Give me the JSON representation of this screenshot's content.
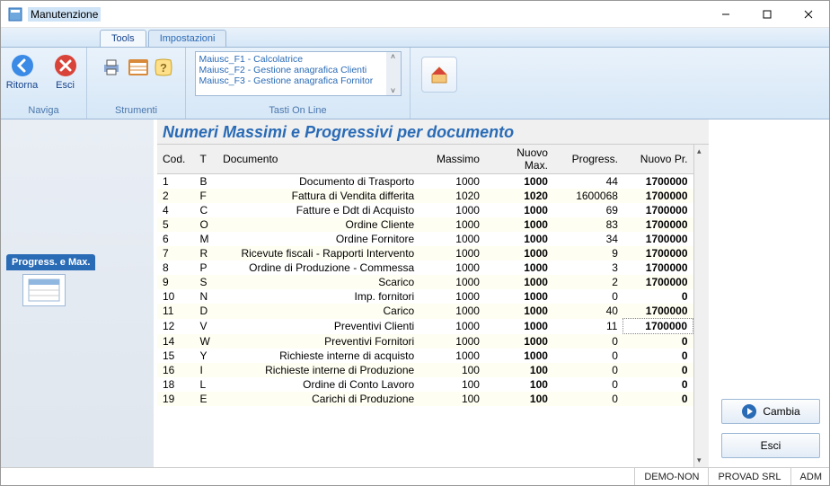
{
  "window": {
    "title": "Manutenzione"
  },
  "tabs": {
    "tools": "Tools",
    "impostazioni": "Impostazioni"
  },
  "ribbon": {
    "naviga": {
      "label": "Naviga",
      "ritorna": "Ritorna",
      "esci": "Esci"
    },
    "strumenti": {
      "label": "Strumenti"
    },
    "tasti": {
      "label": "Tasti On Line",
      "lines": [
        "Maiusc_F1  - Calcolatrice",
        "Maiusc_F2  - Gestione anagrafica Clienti",
        "Maiusc_F3  - Gestione anagrafica Fornitor"
      ]
    }
  },
  "sidebar": {
    "tab": "Progress.  e Max."
  },
  "heading": "Numeri Massimi e Progressivi per documento",
  "columns": {
    "cod": "Cod.",
    "t": "T",
    "documento": "Documento",
    "massimo": "Massimo",
    "nuovomax": "Nuovo Max.",
    "progress": "Progress.",
    "nuovopr": "Nuovo Pr."
  },
  "rows": [
    {
      "cod": "1",
      "t": "B",
      "doc": "Documento di Trasporto",
      "max": "1000",
      "nmax": "1000",
      "prog": "44",
      "npr": "1700000"
    },
    {
      "cod": "2",
      "t": "F",
      "doc": "Fattura di Vendita differita",
      "max": "1020",
      "nmax": "1020",
      "prog": "1600068",
      "npr": "1700000"
    },
    {
      "cod": "4",
      "t": "C",
      "doc": "Fatture e Ddt di Acquisto",
      "max": "1000",
      "nmax": "1000",
      "prog": "69",
      "npr": "1700000"
    },
    {
      "cod": "5",
      "t": "O",
      "doc": "Ordine Cliente",
      "max": "1000",
      "nmax": "1000",
      "prog": "83",
      "npr": "1700000"
    },
    {
      "cod": "6",
      "t": "M",
      "doc": "Ordine Fornitore",
      "max": "1000",
      "nmax": "1000",
      "prog": "34",
      "npr": "1700000"
    },
    {
      "cod": "7",
      "t": "R",
      "doc": "Ricevute fiscali - Rapporti Intervento",
      "max": "1000",
      "nmax": "1000",
      "prog": "9",
      "npr": "1700000"
    },
    {
      "cod": "8",
      "t": "P",
      "doc": "Ordine di Produzione - Commessa",
      "max": "1000",
      "nmax": "1000",
      "prog": "3",
      "npr": "1700000"
    },
    {
      "cod": "9",
      "t": "S",
      "doc": "Scarico",
      "max": "1000",
      "nmax": "1000",
      "prog": "2",
      "npr": "1700000"
    },
    {
      "cod": "10",
      "t": "N",
      "doc": "Imp. fornitori",
      "max": "1000",
      "nmax": "1000",
      "prog": "0",
      "npr": "0"
    },
    {
      "cod": "11",
      "t": "D",
      "doc": "Carico",
      "max": "1000",
      "nmax": "1000",
      "prog": "40",
      "npr": "1700000"
    },
    {
      "cod": "12",
      "t": "V",
      "doc": "Preventivi Clienti",
      "max": "1000",
      "nmax": "1000",
      "prog": "11",
      "npr": "1700000",
      "boxed": true
    },
    {
      "cod": "14",
      "t": "W",
      "doc": "Preventivi Fornitori",
      "max": "1000",
      "nmax": "1000",
      "prog": "0",
      "npr": "0"
    },
    {
      "cod": "15",
      "t": "Y",
      "doc": "Richieste interne di acquisto",
      "max": "1000",
      "nmax": "1000",
      "prog": "0",
      "npr": "0"
    },
    {
      "cod": "16",
      "t": "I",
      "doc": "Richieste interne di Produzione",
      "max": "100",
      "nmax": "100",
      "prog": "0",
      "npr": "0"
    },
    {
      "cod": "18",
      "t": "L",
      "doc": "Ordine di Conto Lavoro",
      "max": "100",
      "nmax": "100",
      "prog": "0",
      "npr": "0"
    },
    {
      "cod": "19",
      "t": "E",
      "doc": "Carichi di Produzione",
      "max": "100",
      "nmax": "100",
      "prog": "0",
      "npr": "0"
    }
  ],
  "buttons": {
    "cambia": "Cambia",
    "esci": "Esci"
  },
  "status": {
    "demo": "DEMO-NON",
    "company": "PROVAD SRL",
    "user": "ADM"
  }
}
